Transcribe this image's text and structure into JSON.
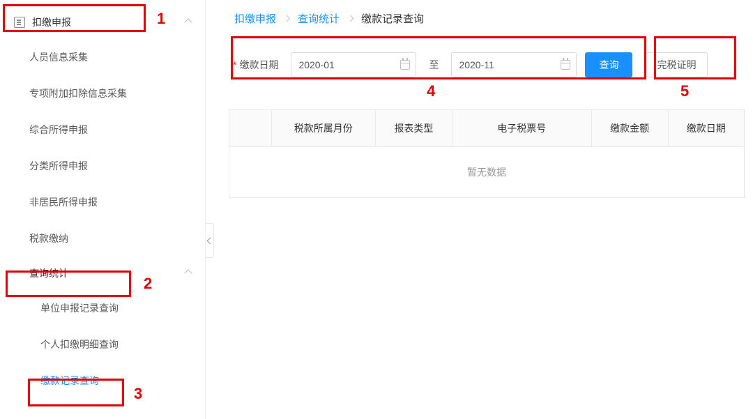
{
  "sidebar": {
    "header_label": "扣缴申报",
    "items": [
      {
        "label": "人员信息采集"
      },
      {
        "label": "专项附加扣除信息采集"
      },
      {
        "label": "综合所得申报"
      },
      {
        "label": "分类所得申报"
      },
      {
        "label": "非居民所得申报"
      },
      {
        "label": "税款缴纳"
      }
    ],
    "query_header": "查询统计",
    "sub_items": [
      {
        "label": "单位申报记录查询"
      },
      {
        "label": "个人扣缴明细查询"
      },
      {
        "label": "缴款记录查询",
        "active": true
      }
    ]
  },
  "breadcrumb": {
    "a": "扣缴申报",
    "b": "查询统计",
    "c": "缴款记录查询"
  },
  "filter": {
    "label": "缴款日期",
    "from": "2020-01",
    "to_text": "至",
    "to": "2020-11",
    "query_btn": "查询",
    "cert_btn": "完税证明"
  },
  "table": {
    "headers": [
      "",
      "税款所属月份",
      "报表类型",
      "电子税票号",
      "缴款金额",
      "缴款日期"
    ],
    "empty_text": "暂无数据"
  },
  "annotations": {
    "1": "1",
    "2": "2",
    "3": "3",
    "4": "4",
    "5": "5"
  }
}
